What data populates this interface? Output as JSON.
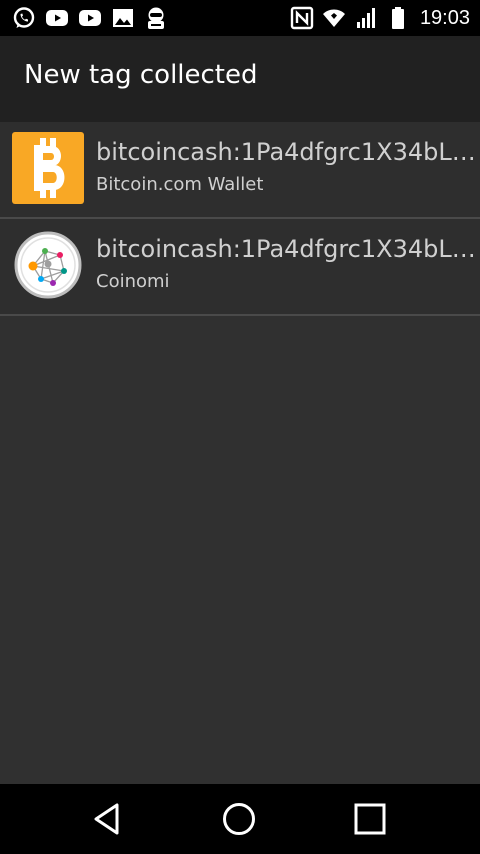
{
  "status_bar": {
    "time": "19:03",
    "left_icons": [
      "whatsapp-icon",
      "youtube-icon",
      "youtube-icon",
      "gallery-icon",
      "app-notification-icon"
    ],
    "right_icons": [
      "nfc-icon",
      "wifi-icon",
      "signal-icon",
      "battery-icon"
    ]
  },
  "app_bar": {
    "title": "New tag collected"
  },
  "list": {
    "items": [
      {
        "title": "bitcoincash:1Pa4dfgrc1X34bL…",
        "subtitle": "Bitcoin.com Wallet",
        "icon": "bitcoin-icon",
        "icon_color": "#f9a825"
      },
      {
        "title": "bitcoincash:1Pa4dfgrc1X34bL…",
        "subtitle": "Coinomi",
        "icon": "coinomi-icon"
      }
    ]
  },
  "nav_bar": {
    "icons": [
      "back-icon",
      "home-icon",
      "recents-icon"
    ]
  },
  "colors": {
    "background": "#303030",
    "app_bar": "#212121",
    "status_bar": "#000000",
    "bitcoin_orange": "#f9a825"
  }
}
